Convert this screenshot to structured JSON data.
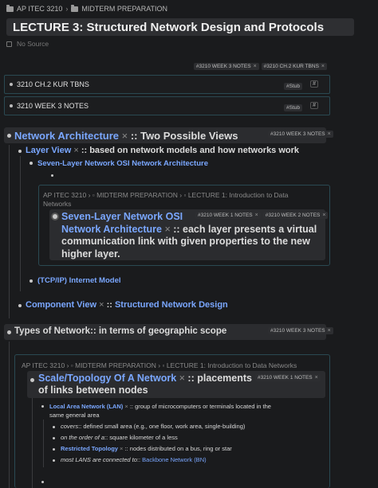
{
  "breadcrumb": {
    "folder1": "AP ITEC 3210",
    "folder2": "MIDTERM PREPARATION"
  },
  "page_title": "LECTURE 3: Structured Network Design and Protocols",
  "source_label": "No Source",
  "top_tags": [
    "#3210 WEEK 3 NOTES",
    "#3210 CH.2 KUR TBNS"
  ],
  "refs": [
    {
      "label": "3210 CH.2 KUR TBNS",
      "stub": "#Stub",
      "hash": "#"
    },
    {
      "label": "3210 WEEK 3 NOTES",
      "stub": "#Stub",
      "hash": "#"
    }
  ],
  "net_arch": {
    "link": "Network Architecture",
    "rest": ":: Two Possible Views",
    "tag": "#3210 WEEK 3 NOTES"
  },
  "layer_view": {
    "link": "Layer View",
    "rest": ":: based on network models and how networks work"
  },
  "osi": {
    "link": "Seven-Layer Network OSI Network Architecture"
  },
  "embed1": {
    "crumb1": "AP ITEC 3210",
    "crumb2": "MIDTERM PREPARATION",
    "crumb3": "LECTURE 1: Introduction to Data",
    "crumb4": "Networks",
    "link1": "Seven-Layer Network OSI",
    "link2": "Network Architecture",
    "rest1": ":: each layer presents a virtual",
    "rest2": "communication link with given properties to the new",
    "rest3": "higher layer.",
    "tags": [
      "#3210 WEEK 1 NOTES",
      "#3210 WEEK 2 NOTES"
    ]
  },
  "tcpip": {
    "link": "(TCP/IP) Internet Model"
  },
  "component_view": {
    "link": "Component View",
    "rest": ":: ",
    "link2": "Structured Network Design"
  },
  "types": {
    "text": "Types of Network:: in terms of geographic scope",
    "tag": "#3210 WEEK 3 NOTES"
  },
  "embed2": {
    "crumb1": "AP ITEC 3210",
    "crumb2": "MIDTERM PREPARATION",
    "crumb3": "LECTURE 1: Introduction to Data Networks",
    "link": "Scale/Topology Of A Network",
    "rest1": ":: placements",
    "rest2": "of links between nodes",
    "tag": "#3210 WEEK 1 NOTES",
    "lan_link": "Local Area Network (LAN)",
    "lan_rest1": ":: group of microcomputers or terminals located in the",
    "lan_rest2": "same general area",
    "covers": "covers",
    "covers_rest": ":: defined small area (e.g., one floor, work area, single-building)",
    "order": "on the order of a",
    "order_rest": ":: square kilometer of a less",
    "restricted_link": "Restricted Topology",
    "restricted_rest": ":: nodes distributed on a bus, ring or star",
    "most": "most LANS are connected to",
    "most_rest": ":: ",
    "backbone_link": "Backbone Network (BN)"
  }
}
